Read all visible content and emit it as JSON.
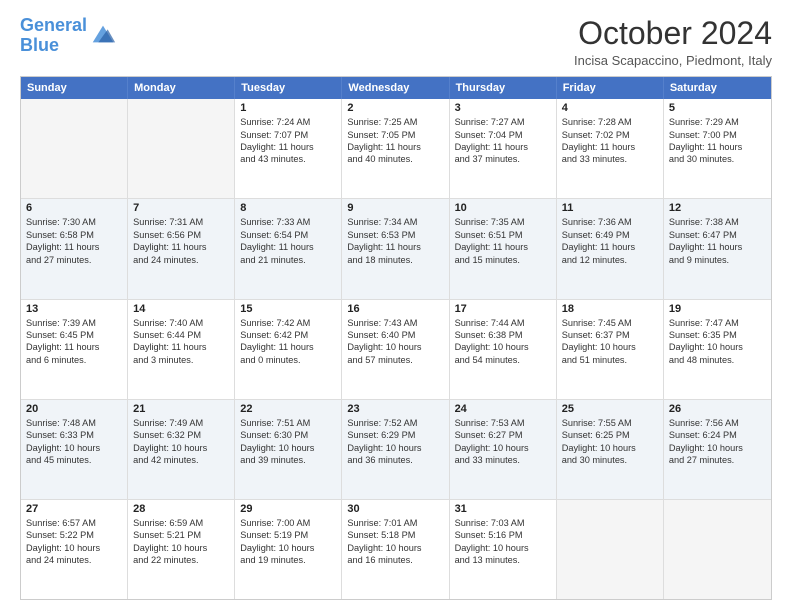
{
  "header": {
    "logo_line1": "General",
    "logo_line2": "Blue",
    "month": "October 2024",
    "location": "Incisa Scapaccino, Piedmont, Italy"
  },
  "weekdays": [
    "Sunday",
    "Monday",
    "Tuesday",
    "Wednesday",
    "Thursday",
    "Friday",
    "Saturday"
  ],
  "rows": [
    [
      {
        "day": "",
        "lines": []
      },
      {
        "day": "",
        "lines": []
      },
      {
        "day": "1",
        "lines": [
          "Sunrise: 7:24 AM",
          "Sunset: 7:07 PM",
          "Daylight: 11 hours",
          "and 43 minutes."
        ]
      },
      {
        "day": "2",
        "lines": [
          "Sunrise: 7:25 AM",
          "Sunset: 7:05 PM",
          "Daylight: 11 hours",
          "and 40 minutes."
        ]
      },
      {
        "day": "3",
        "lines": [
          "Sunrise: 7:27 AM",
          "Sunset: 7:04 PM",
          "Daylight: 11 hours",
          "and 37 minutes."
        ]
      },
      {
        "day": "4",
        "lines": [
          "Sunrise: 7:28 AM",
          "Sunset: 7:02 PM",
          "Daylight: 11 hours",
          "and 33 minutes."
        ]
      },
      {
        "day": "5",
        "lines": [
          "Sunrise: 7:29 AM",
          "Sunset: 7:00 PM",
          "Daylight: 11 hours",
          "and 30 minutes."
        ]
      }
    ],
    [
      {
        "day": "6",
        "lines": [
          "Sunrise: 7:30 AM",
          "Sunset: 6:58 PM",
          "Daylight: 11 hours",
          "and 27 minutes."
        ]
      },
      {
        "day": "7",
        "lines": [
          "Sunrise: 7:31 AM",
          "Sunset: 6:56 PM",
          "Daylight: 11 hours",
          "and 24 minutes."
        ]
      },
      {
        "day": "8",
        "lines": [
          "Sunrise: 7:33 AM",
          "Sunset: 6:54 PM",
          "Daylight: 11 hours",
          "and 21 minutes."
        ]
      },
      {
        "day": "9",
        "lines": [
          "Sunrise: 7:34 AM",
          "Sunset: 6:53 PM",
          "Daylight: 11 hours",
          "and 18 minutes."
        ]
      },
      {
        "day": "10",
        "lines": [
          "Sunrise: 7:35 AM",
          "Sunset: 6:51 PM",
          "Daylight: 11 hours",
          "and 15 minutes."
        ]
      },
      {
        "day": "11",
        "lines": [
          "Sunrise: 7:36 AM",
          "Sunset: 6:49 PM",
          "Daylight: 11 hours",
          "and 12 minutes."
        ]
      },
      {
        "day": "12",
        "lines": [
          "Sunrise: 7:38 AM",
          "Sunset: 6:47 PM",
          "Daylight: 11 hours",
          "and 9 minutes."
        ]
      }
    ],
    [
      {
        "day": "13",
        "lines": [
          "Sunrise: 7:39 AM",
          "Sunset: 6:45 PM",
          "Daylight: 11 hours",
          "and 6 minutes."
        ]
      },
      {
        "day": "14",
        "lines": [
          "Sunrise: 7:40 AM",
          "Sunset: 6:44 PM",
          "Daylight: 11 hours",
          "and 3 minutes."
        ]
      },
      {
        "day": "15",
        "lines": [
          "Sunrise: 7:42 AM",
          "Sunset: 6:42 PM",
          "Daylight: 11 hours",
          "and 0 minutes."
        ]
      },
      {
        "day": "16",
        "lines": [
          "Sunrise: 7:43 AM",
          "Sunset: 6:40 PM",
          "Daylight: 10 hours",
          "and 57 minutes."
        ]
      },
      {
        "day": "17",
        "lines": [
          "Sunrise: 7:44 AM",
          "Sunset: 6:38 PM",
          "Daylight: 10 hours",
          "and 54 minutes."
        ]
      },
      {
        "day": "18",
        "lines": [
          "Sunrise: 7:45 AM",
          "Sunset: 6:37 PM",
          "Daylight: 10 hours",
          "and 51 minutes."
        ]
      },
      {
        "day": "19",
        "lines": [
          "Sunrise: 7:47 AM",
          "Sunset: 6:35 PM",
          "Daylight: 10 hours",
          "and 48 minutes."
        ]
      }
    ],
    [
      {
        "day": "20",
        "lines": [
          "Sunrise: 7:48 AM",
          "Sunset: 6:33 PM",
          "Daylight: 10 hours",
          "and 45 minutes."
        ]
      },
      {
        "day": "21",
        "lines": [
          "Sunrise: 7:49 AM",
          "Sunset: 6:32 PM",
          "Daylight: 10 hours",
          "and 42 minutes."
        ]
      },
      {
        "day": "22",
        "lines": [
          "Sunrise: 7:51 AM",
          "Sunset: 6:30 PM",
          "Daylight: 10 hours",
          "and 39 minutes."
        ]
      },
      {
        "day": "23",
        "lines": [
          "Sunrise: 7:52 AM",
          "Sunset: 6:29 PM",
          "Daylight: 10 hours",
          "and 36 minutes."
        ]
      },
      {
        "day": "24",
        "lines": [
          "Sunrise: 7:53 AM",
          "Sunset: 6:27 PM",
          "Daylight: 10 hours",
          "and 33 minutes."
        ]
      },
      {
        "day": "25",
        "lines": [
          "Sunrise: 7:55 AM",
          "Sunset: 6:25 PM",
          "Daylight: 10 hours",
          "and 30 minutes."
        ]
      },
      {
        "day": "26",
        "lines": [
          "Sunrise: 7:56 AM",
          "Sunset: 6:24 PM",
          "Daylight: 10 hours",
          "and 27 minutes."
        ]
      }
    ],
    [
      {
        "day": "27",
        "lines": [
          "Sunrise: 6:57 AM",
          "Sunset: 5:22 PM",
          "Daylight: 10 hours",
          "and 24 minutes."
        ]
      },
      {
        "day": "28",
        "lines": [
          "Sunrise: 6:59 AM",
          "Sunset: 5:21 PM",
          "Daylight: 10 hours",
          "and 22 minutes."
        ]
      },
      {
        "day": "29",
        "lines": [
          "Sunrise: 7:00 AM",
          "Sunset: 5:19 PM",
          "Daylight: 10 hours",
          "and 19 minutes."
        ]
      },
      {
        "day": "30",
        "lines": [
          "Sunrise: 7:01 AM",
          "Sunset: 5:18 PM",
          "Daylight: 10 hours",
          "and 16 minutes."
        ]
      },
      {
        "day": "31",
        "lines": [
          "Sunrise: 7:03 AM",
          "Sunset: 5:16 PM",
          "Daylight: 10 hours",
          "and 13 minutes."
        ]
      },
      {
        "day": "",
        "lines": []
      },
      {
        "day": "",
        "lines": []
      }
    ]
  ]
}
